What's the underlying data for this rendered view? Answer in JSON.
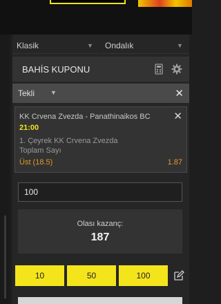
{
  "filters": {
    "mode": "Klasik",
    "odds_format": "Ondalık"
  },
  "betslip": {
    "title": "BAHİS KUPONU",
    "type": "Tekli",
    "selection": {
      "match": "KK Crvena Zvezda - Panathinaikos BC",
      "time": "21:00",
      "market_line1": "1. Çeyrek KK Crvena Zvezda",
      "market_line2": "Toplam Sayı",
      "outcome": "Üst (18.5)",
      "odds": "1.87"
    },
    "stake_value": "100",
    "potential_win_label": "Olası kazanç:",
    "potential_win_value": "187",
    "quick_stakes": [
      "10",
      "50",
      "100"
    ]
  },
  "colors": {
    "accent": "#f4e41c",
    "odds": "#e09a2a",
    "background": "#1e1e1e"
  },
  "icons": [
    "calculator-icon",
    "gear-icon",
    "close-icon",
    "chevron-down-icon",
    "edit-icon"
  ]
}
